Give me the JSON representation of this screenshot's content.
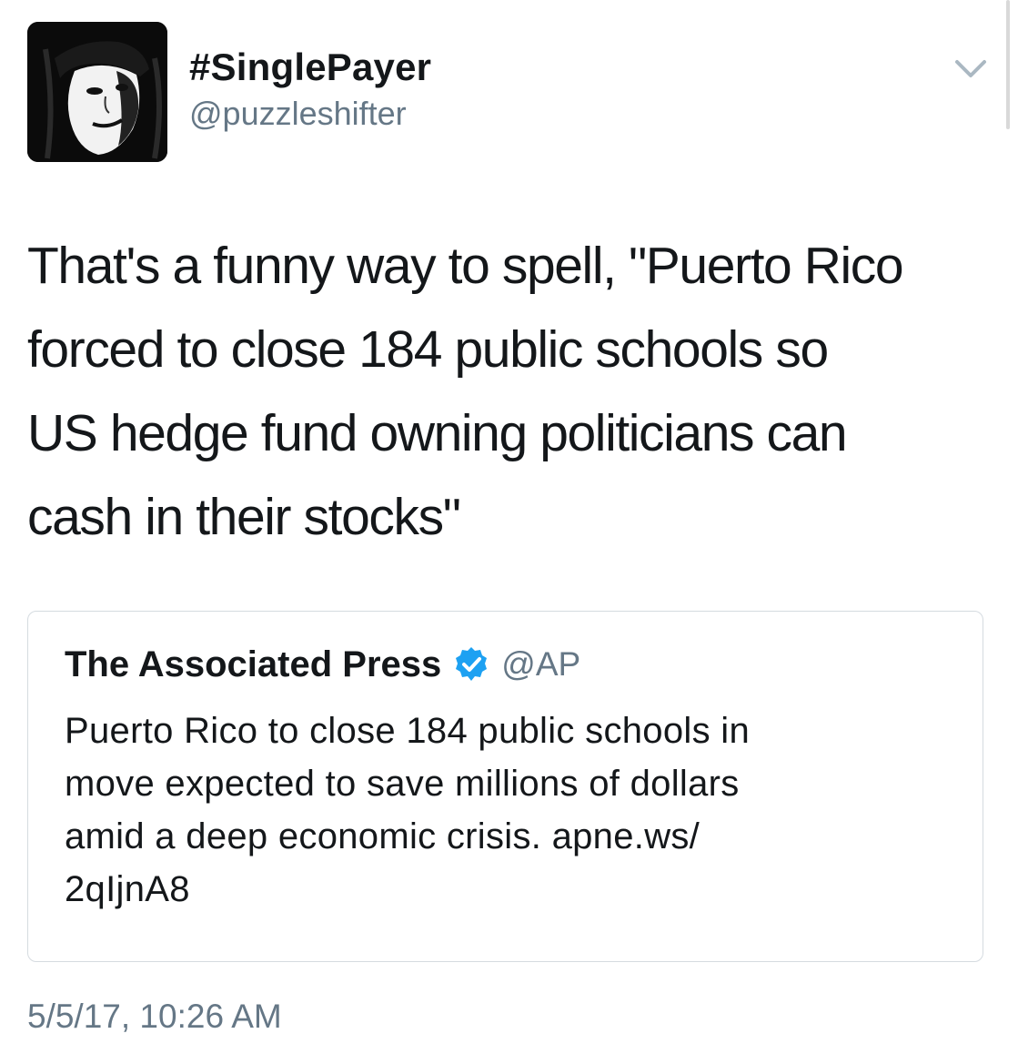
{
  "tweet": {
    "display_name": "#SinglePayer",
    "handle": "@puzzleshifter",
    "text_lines": [
      "That's a funny way to spell, \"Puerto Rico",
      "forced to close 184 public schools so",
      "US hedge fund owning politicians can",
      "cash in their stocks\""
    ],
    "timestamp": "5/5/17, 10:26 AM",
    "caret_icon": "chevron-down-icon"
  },
  "quoted_tweet": {
    "display_name": "The Associated Press",
    "verified_icon": "verified-badge-icon",
    "verified_color": "#1da1f2",
    "handle": "@AP",
    "text_lines": [
      "Puerto Rico to close 184 public schools in",
      "move expected to save millions of dollars",
      "amid a deep economic crisis. apne.ws/",
      "2qIjnA8"
    ]
  },
  "colors": {
    "text_primary": "#14171a",
    "text_secondary": "#657786",
    "border": "#d5dbe0"
  }
}
